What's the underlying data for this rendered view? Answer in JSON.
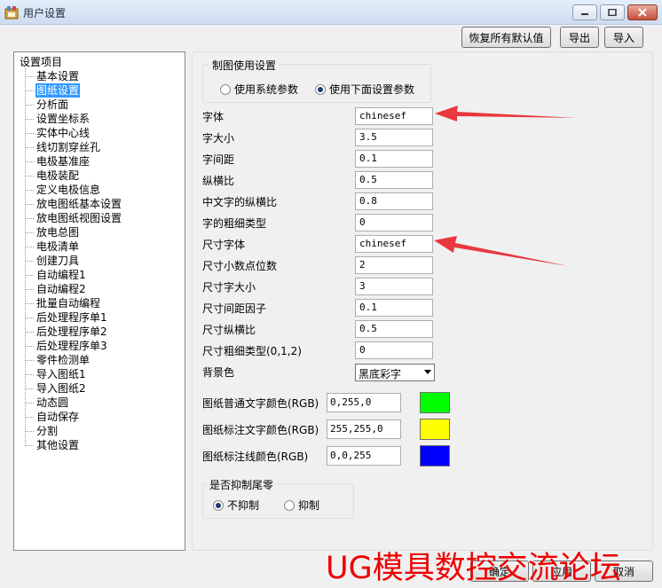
{
  "window": {
    "title": "用户设置"
  },
  "toolbar": {
    "restore_defaults": "恢复所有默认值",
    "export": "导出",
    "import": "导入"
  },
  "tree": {
    "root": "设置项目",
    "items": [
      "基本设置",
      "图纸设置",
      "分析面",
      "设置坐标系",
      "实体中心线",
      "线切割穿丝孔",
      "电极基准座",
      "电极装配",
      "定义电极信息",
      "放电图纸基本设置",
      "放电图纸视图设置",
      "放电总图",
      "电极清单",
      "创建刀具",
      "自动编程1",
      "自动编程2",
      "批量自动编程",
      "后处理程序单1",
      "后处理程序单2",
      "后处理程序单3",
      "零件检测单",
      "导入图纸1",
      "导入图纸2",
      "动态圆",
      "自动保存",
      "分割",
      "其他设置"
    ],
    "selected_index": 1
  },
  "drawing_settings": {
    "group_title": "制图使用设置",
    "option_system": "使用系统参数",
    "option_below": "使用下面设置参数",
    "selected": "option_below"
  },
  "fields": [
    {
      "label": "字体",
      "value": "chinesef"
    },
    {
      "label": "字大小",
      "value": "3.5"
    },
    {
      "label": "字间距",
      "value": "0.1"
    },
    {
      "label": "纵横比",
      "value": "0.5"
    },
    {
      "label": "中文字的纵横比",
      "value": "0.8"
    },
    {
      "label": "字的粗细类型",
      "value": "0"
    },
    {
      "label": "尺寸字体",
      "value": "chinesef"
    },
    {
      "label": "尺寸小数点位数",
      "value": "2"
    },
    {
      "label": "尺寸字大小",
      "value": "3"
    },
    {
      "label": "尺寸间距因子",
      "value": "0.1"
    },
    {
      "label": "尺寸纵横比",
      "value": "0.5"
    },
    {
      "label": "尺寸粗细类型(0,1,2)",
      "value": "0"
    }
  ],
  "background": {
    "label": "背景色",
    "value": "黑底彩字"
  },
  "colors": [
    {
      "label": "图纸普通文字颜色(RGB)",
      "value": "0,255,0",
      "swatch": "#00ff00"
    },
    {
      "label": "图纸标注文字颜色(RGB)",
      "value": "255,255,0",
      "swatch": "#ffff00"
    },
    {
      "label": "图纸标注线颜色(RGB)",
      "value": "0,0,255",
      "swatch": "#0000ff"
    }
  ],
  "suppress_zero": {
    "group_title": "是否抑制尾零",
    "option_no": "不抑制",
    "option_yes": "抑制",
    "selected": "option_no"
  },
  "bottom_buttons": {
    "ok": "确定",
    "apply": "应用",
    "cancel": "取消"
  },
  "watermark": "UG模具数控交流论坛",
  "annotation_color": "#e8383d"
}
